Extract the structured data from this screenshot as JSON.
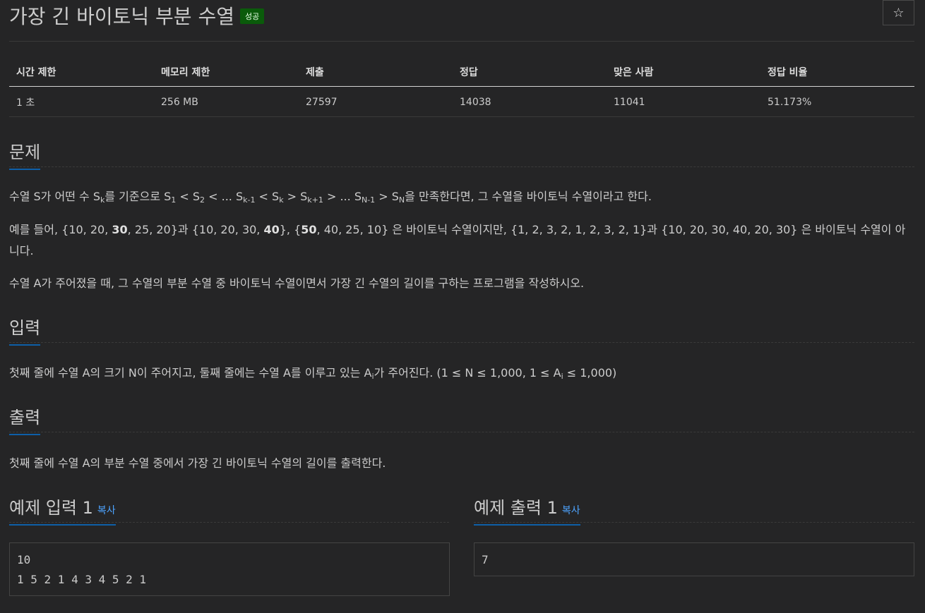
{
  "problem": {
    "title": "가장 긴 바이토닉 부분 수열",
    "badge": "성공",
    "star": "☆"
  },
  "stats": {
    "headers": [
      "시간 제한",
      "메모리 제한",
      "제출",
      "정답",
      "맞은 사람",
      "정답 비율"
    ],
    "values": [
      "1 초",
      "256 MB",
      "27597",
      "14038",
      "11041",
      "51.173%"
    ]
  },
  "sections": {
    "problem_heading": "문제",
    "input_heading": "입력",
    "output_heading": "출력"
  },
  "problem_text": {
    "p1_a": "수열 S가 어떤 수 S",
    "p1_k": "k",
    "p1_b": "를 기준으로 S",
    "p1_1": "1",
    "p1_c": " < S",
    "p1_2": "2",
    "p1_d": " < ... S",
    "p1_km1": "k-1",
    "p1_e": " < S",
    "p1_k2": "k",
    "p1_f": " > S",
    "p1_kp1": "k+1",
    "p1_g": " > ... S",
    "p1_nm1": "N-1",
    "p1_h": " > S",
    "p1_n": "N",
    "p1_i": "을 만족한다면, 그 수열을 바이토닉 수열이라고 한다.",
    "p2_a": "예를 들어, {10, 20, ",
    "p2_b1": "30",
    "p2_c": ", 25, 20}과 {10, 20, 30, ",
    "p2_b2": "40",
    "p2_d": "}, {",
    "p2_b3": "50",
    "p2_e": ", 40, 25, 10} 은 바이토닉 수열이지만,  {1, 2, 3, 2, 1, 2, 3, 2, 1}과 {10, 20, 30, 40, 20, 30} 은 바이토닉 수열이 아니다.",
    "p3": "수열 A가 주어졌을 때, 그 수열의 부분 수열 중 바이토닉 수열이면서 가장 긴 수열의 길이를 구하는 프로그램을 작성하시오."
  },
  "input_text": {
    "a": "첫째 줄에 수열 A의 크기 N이 주어지고, 둘째 줄에는 수열 A를 이루고 있는 A",
    "i": "i",
    "b": "가 주어진다. (1 ≤ N ≤ 1,000, 1 ≤ A",
    "i2": "i",
    "c": " ≤ 1,000)"
  },
  "output_text": "첫째 줄에 수열 A의 부분 수열 중에서 가장 긴 바이토닉 수열의 길이를 출력한다.",
  "samples": {
    "input_heading": "예제 입력 1",
    "output_heading": "예제 출력 1",
    "copy_label": "복사",
    "input_value": "10\n1 5 2 1 4 3 4 5 2 1",
    "output_value": "7"
  }
}
